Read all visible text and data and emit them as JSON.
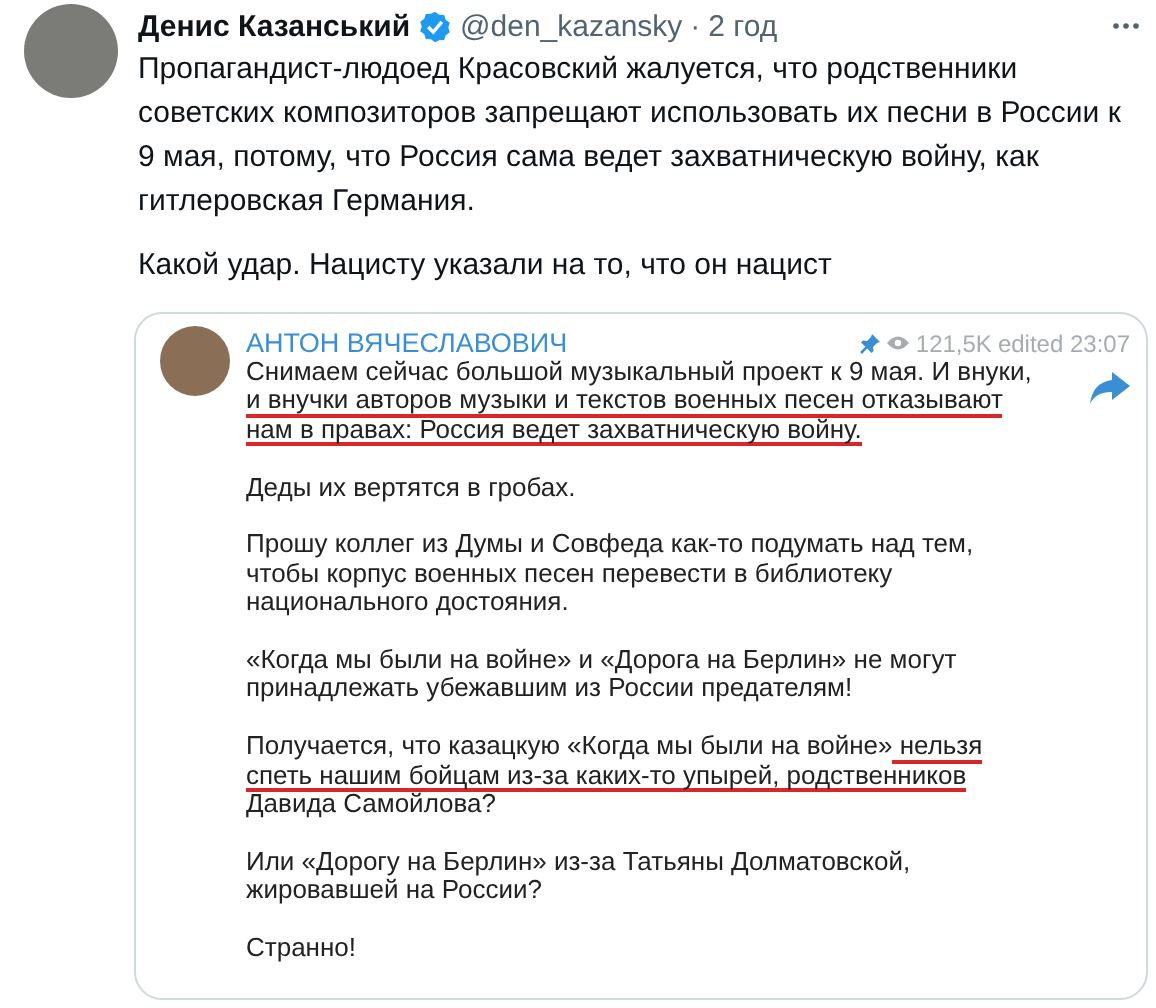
{
  "tweet": {
    "author": "Денис Казанський",
    "verified": true,
    "handle": "@den_kazansky",
    "separator": "·",
    "time": "2 год",
    "paragraphs": [
      [
        "Пропагандист-людоед Красовский жалуется, что родственники",
        "советских композиторов запрещают использовать их песни в России к",
        "9 мая, потому, что Россия сама ведет захватническую войну, как",
        "гитлеровская Германия."
      ],
      [
        "Какой удар. Нацисту указали на то, что он нацист"
      ]
    ]
  },
  "quoted_post": {
    "channel": "АНТОН ВЯЧЕСЛАВОВИЧ",
    "pinned": true,
    "views": "121,5K",
    "edited": "edited 23:07",
    "paragraphs": [
      {
        "lines": [
          [
            {
              "text": "Снимаем сейчас большой музыкальный проект к 9 мая. И внуки,",
              "underlined": false
            }
          ],
          [
            {
              "text": "и внучки авторов музыки и текстов военных песен отказывают",
              "underlined": true
            }
          ],
          [
            {
              "text": "нам в правах: Россия ведет захватническую войну.",
              "underlined": true
            }
          ]
        ]
      },
      {
        "lines": [
          [
            {
              "text": "Деды их вертятся в гробах.",
              "underlined": false
            }
          ]
        ]
      },
      {
        "lines": [
          [
            {
              "text": "Прошу коллег из Думы и Совфеда как-то подумать над тем,",
              "underlined": false
            }
          ],
          [
            {
              "text": "чтобы корпус военных песен перевести в библиотеку",
              "underlined": false
            }
          ],
          [
            {
              "text": "национального достояния.",
              "underlined": false
            }
          ]
        ]
      },
      {
        "lines": [
          [
            {
              "text": "«Когда мы были на войне» и «Дорога на Берлин» не могут",
              "underlined": false
            }
          ],
          [
            {
              "text": "принадлежать убежавшим из России предателям!",
              "underlined": false
            }
          ]
        ]
      },
      {
        "lines": [
          [
            {
              "text": "Получается, что казацкую «Когда мы были на войне»",
              "underlined": false
            },
            {
              "text": " нельзя",
              "underlined": true
            }
          ],
          [
            {
              "text": "спеть нашим бойцам из-за каких-то упырей, родственников",
              "underlined": true
            }
          ],
          [
            {
              "text": "Давида Самойлова?",
              "underlined": false
            }
          ]
        ]
      },
      {
        "lines": [
          [
            {
              "text": "Или «Дорогу на Берлин» из-за Татьяны Долматовской,",
              "underlined": false
            }
          ],
          [
            {
              "text": "жировавшей на России?",
              "underlined": false
            }
          ]
        ]
      },
      {
        "lines": [
          [
            {
              "text": "Странно!",
              "underlined": false
            }
          ]
        ]
      }
    ]
  }
}
